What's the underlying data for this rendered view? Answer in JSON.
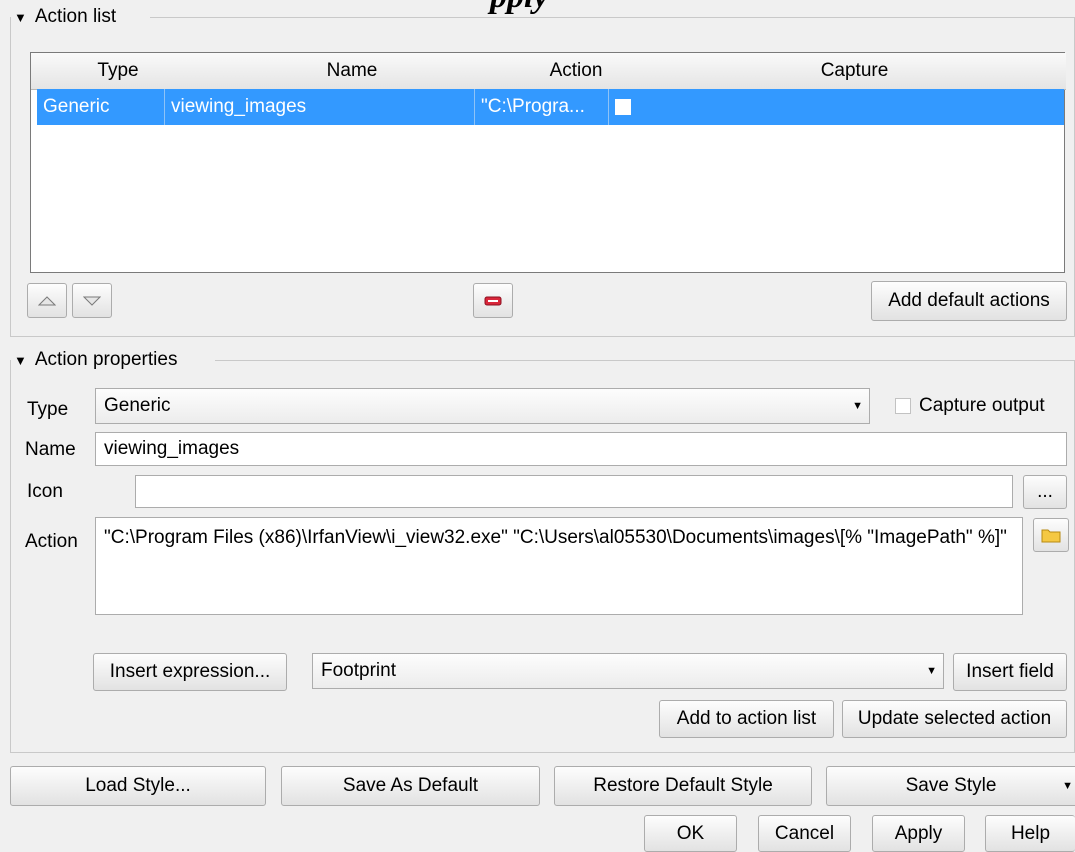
{
  "top_cut_text": "pply",
  "action_list": {
    "title": "Action list",
    "columns": [
      "Type",
      "Name",
      "Action",
      "Capture"
    ],
    "rows": [
      {
        "type": "Generic",
        "name": "viewing_images",
        "action": "\"C:\\Progra...",
        "capture": false
      }
    ],
    "add_default_label": "Add default actions"
  },
  "props": {
    "title": "Action properties",
    "type_label": "Type",
    "type_value": "Generic",
    "capture_label": "Capture output",
    "name_label": "Name",
    "name_value": "viewing_images",
    "icon_label": "Icon",
    "icon_value": "",
    "browse_label": "...",
    "action_label": "Action",
    "action_value": "\"C:\\Program Files (x86)\\IrfanView\\i_view32.exe\" \"C:\\Users\\al05530\\Documents\\images\\[% \"ImagePath\" %]\"",
    "insert_expression_label": "Insert expression...",
    "field_value": "Footprint",
    "insert_field_label": "Insert field",
    "add_to_list_label": "Add to action list",
    "update_selected_label": "Update selected action"
  },
  "style_buttons": {
    "load": "Load Style...",
    "save_default": "Save As Default",
    "restore": "Restore Default Style",
    "save": "Save Style"
  },
  "dialog_buttons": {
    "ok": "OK",
    "cancel": "Cancel",
    "apply": "Apply",
    "help": "Help"
  },
  "colors": {
    "selection": "#3399ff",
    "remove_icon": "#d9263a",
    "folder_icon": "#f5c842"
  },
  "icons": [
    "move-up-icon",
    "move-down-icon",
    "remove-action-icon",
    "folder-icon",
    "dropdown-arrow-icon"
  ]
}
